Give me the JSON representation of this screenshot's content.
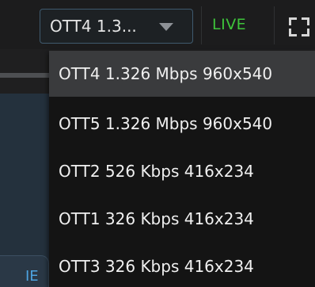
{
  "player": {
    "quality_select_value": "OTT4 1.3...",
    "live_label": "LIVE",
    "background_tab_label": "IE"
  },
  "quality_menu": {
    "items": [
      {
        "label": "OTT4 1.326 Mbps 960x540",
        "selected": true
      },
      {
        "label": "OTT5 1.326 Mbps 960x540",
        "selected": false
      },
      {
        "label": "OTT2 526 Kbps 416x234",
        "selected": false
      },
      {
        "label": "OTT1 326 Kbps 416x234",
        "selected": false
      },
      {
        "label": "OTT3 326 Kbps 416x234",
        "selected": false
      }
    ]
  },
  "icons": {
    "dropdown": "chevron-down-icon",
    "fullscreen": "fullscreen-icon"
  },
  "colors": {
    "live": "#3ec43a",
    "select_border": "#3f5a6e",
    "menu_background": "#141414",
    "menu_selected": "#3a3b3d"
  }
}
